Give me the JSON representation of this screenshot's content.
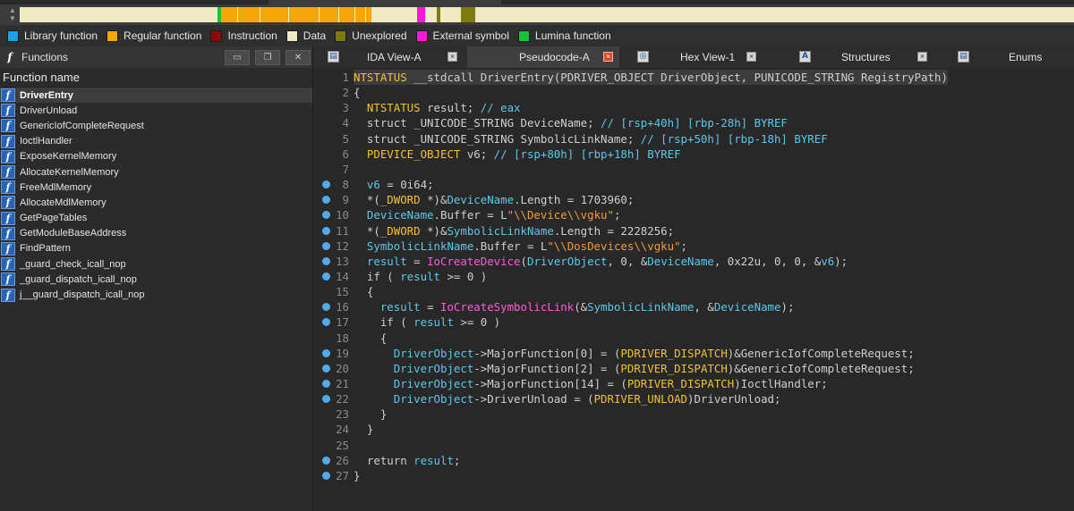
{
  "legend": [
    {
      "label": "Library function",
      "color": "#1aa3e8"
    },
    {
      "label": "Regular function",
      "color": "#f6a50a"
    },
    {
      "label": "Instruction",
      "color": "#8b0a0a"
    },
    {
      "label": "Data",
      "color": "#efe9c4"
    },
    {
      "label": "Unexplored",
      "color": "#7e7a10"
    },
    {
      "label": "External symbol",
      "color": "#ff19d4"
    },
    {
      "label": "Lumina function",
      "color": "#19c23a"
    }
  ],
  "functions_panel": {
    "title": "Functions",
    "column_header": "Function name",
    "items": [
      "DriverEntry",
      "DriverUnload",
      "GenericIofCompleteRequest",
      "IoctlHandler",
      "ExposeKernelMemory",
      "AllocateKernelMemory",
      "FreeMdlMemory",
      "AllocateMdlMemory",
      "GetPageTables",
      "GetModuleBaseAddress",
      "FindPattern",
      "_guard_check_icall_nop",
      "_guard_dispatch_icall_nop",
      "j__guard_dispatch_icall_nop"
    ],
    "selected_index": 0
  },
  "tabs": [
    {
      "label": "IDA View-A",
      "active": false,
      "icon": "ida-view-icon"
    },
    {
      "label": "Pseudocode-A",
      "active": true,
      "icon": "pseudocode-icon"
    },
    {
      "label": "Hex View-1",
      "active": false,
      "icon": "hex-view-icon"
    },
    {
      "label": "Structures",
      "active": false,
      "icon": "structures-icon"
    },
    {
      "label": "Enums",
      "active": false,
      "icon": "enums-icon"
    }
  ],
  "code": {
    "highlighted_line": 1,
    "breakpoint_lines": [
      8,
      9,
      10,
      11,
      12,
      13,
      14,
      16,
      17,
      19,
      20,
      21,
      22,
      26,
      27
    ],
    "lines": [
      [
        [
          "t",
          "NTSTATUS"
        ],
        [
          "k",
          " __stdcall DriverEntry(PDRIVER_OBJECT DriverObject, PUNICODE_STRING RegistryPath)"
        ]
      ],
      [
        [
          "p",
          "{"
        ]
      ],
      [
        [
          "k",
          "  "
        ],
        [
          "t",
          "NTSTATUS"
        ],
        [
          "k",
          " result; "
        ],
        [
          "c",
          "// eax"
        ]
      ],
      [
        [
          "k",
          "  struct _UNICODE_STRING DeviceName; "
        ],
        [
          "c",
          "// [rsp+40h] [rbp-28h] BYREF"
        ]
      ],
      [
        [
          "k",
          "  struct _UNICODE_STRING SymbolicLinkName; "
        ],
        [
          "c",
          "// [rsp+50h] [rbp-18h] BYREF"
        ]
      ],
      [
        [
          "k",
          "  "
        ],
        [
          "t",
          "PDEVICE_OBJECT"
        ],
        [
          "k",
          " v6; "
        ],
        [
          "c",
          "// [rsp+80h] [rbp+18h] BYREF"
        ]
      ],
      [],
      [
        [
          "k",
          "  "
        ],
        [
          "id",
          "v6"
        ],
        [
          "k",
          " = 0i64;"
        ]
      ],
      [
        [
          "k",
          "  *("
        ],
        [
          "t",
          "_DWORD"
        ],
        [
          "k",
          " *)&"
        ],
        [
          "id",
          "DeviceName"
        ],
        [
          "k",
          ".Length = 1703960;"
        ]
      ],
      [
        [
          "k",
          "  "
        ],
        [
          "id",
          "DeviceName"
        ],
        [
          "k",
          ".Buffer = L"
        ],
        [
          "s",
          "\"\\\\Device\\\\vgku\""
        ],
        [
          "k",
          ";"
        ]
      ],
      [
        [
          "k",
          "  *("
        ],
        [
          "t",
          "_DWORD"
        ],
        [
          "k",
          " *)&"
        ],
        [
          "id",
          "SymbolicLinkName"
        ],
        [
          "k",
          ".Length = 2228256;"
        ]
      ],
      [
        [
          "k",
          "  "
        ],
        [
          "id",
          "SymbolicLinkName"
        ],
        [
          "k",
          ".Buffer = L"
        ],
        [
          "s",
          "\"\\\\DosDevices\\\\vgku\""
        ],
        [
          "k",
          ";"
        ]
      ],
      [
        [
          "k",
          "  "
        ],
        [
          "id",
          "result"
        ],
        [
          "k",
          " = "
        ],
        [
          "fn",
          "IoCreateDevice"
        ],
        [
          "k",
          "("
        ],
        [
          "id",
          "DriverObject"
        ],
        [
          "k",
          ", 0, &"
        ],
        [
          "id",
          "DeviceName"
        ],
        [
          "k",
          ", 0x22u, 0, 0, &"
        ],
        [
          "id",
          "v6"
        ],
        [
          "k",
          ");"
        ]
      ],
      [
        [
          "k",
          "  if ( "
        ],
        [
          "id",
          "result"
        ],
        [
          "k",
          " >= 0 )"
        ]
      ],
      [
        [
          "k",
          "  {"
        ]
      ],
      [
        [
          "k",
          "    "
        ],
        [
          "id",
          "result"
        ],
        [
          "k",
          " = "
        ],
        [
          "fn",
          "IoCreateSymbolicLink"
        ],
        [
          "k",
          "(&"
        ],
        [
          "id",
          "SymbolicLinkName"
        ],
        [
          "k",
          ", &"
        ],
        [
          "id",
          "DeviceName"
        ],
        [
          "k",
          ");"
        ]
      ],
      [
        [
          "k",
          "    if ( "
        ],
        [
          "id",
          "result"
        ],
        [
          "k",
          " >= 0 )"
        ]
      ],
      [
        [
          "k",
          "    {"
        ]
      ],
      [
        [
          "k",
          "      "
        ],
        [
          "id",
          "DriverObject"
        ],
        [
          "k",
          "->MajorFunction[0] = ("
        ],
        [
          "t",
          "PDRIVER_DISPATCH"
        ],
        [
          "k",
          ")&GenericIofCompleteRequest;"
        ]
      ],
      [
        [
          "k",
          "      "
        ],
        [
          "id",
          "DriverObject"
        ],
        [
          "k",
          "->MajorFunction[2] = ("
        ],
        [
          "t",
          "PDRIVER_DISPATCH"
        ],
        [
          "k",
          ")&GenericIofCompleteRequest;"
        ]
      ],
      [
        [
          "k",
          "      "
        ],
        [
          "id",
          "DriverObject"
        ],
        [
          "k",
          "->MajorFunction[14] = ("
        ],
        [
          "t",
          "PDRIVER_DISPATCH"
        ],
        [
          "k",
          ")IoctlHandler;"
        ]
      ],
      [
        [
          "k",
          "      "
        ],
        [
          "id",
          "DriverObject"
        ],
        [
          "k",
          "->DriverUnload = ("
        ],
        [
          "t",
          "PDRIVER_UNLOAD"
        ],
        [
          "k",
          ")DriverUnload;"
        ]
      ],
      [
        [
          "k",
          "    }"
        ]
      ],
      [
        [
          "k",
          "  }"
        ]
      ],
      [],
      [
        [
          "k",
          "  return "
        ],
        [
          "id",
          "result"
        ],
        [
          "k",
          ";"
        ]
      ],
      [
        [
          "p",
          "}"
        ]
      ]
    ]
  }
}
